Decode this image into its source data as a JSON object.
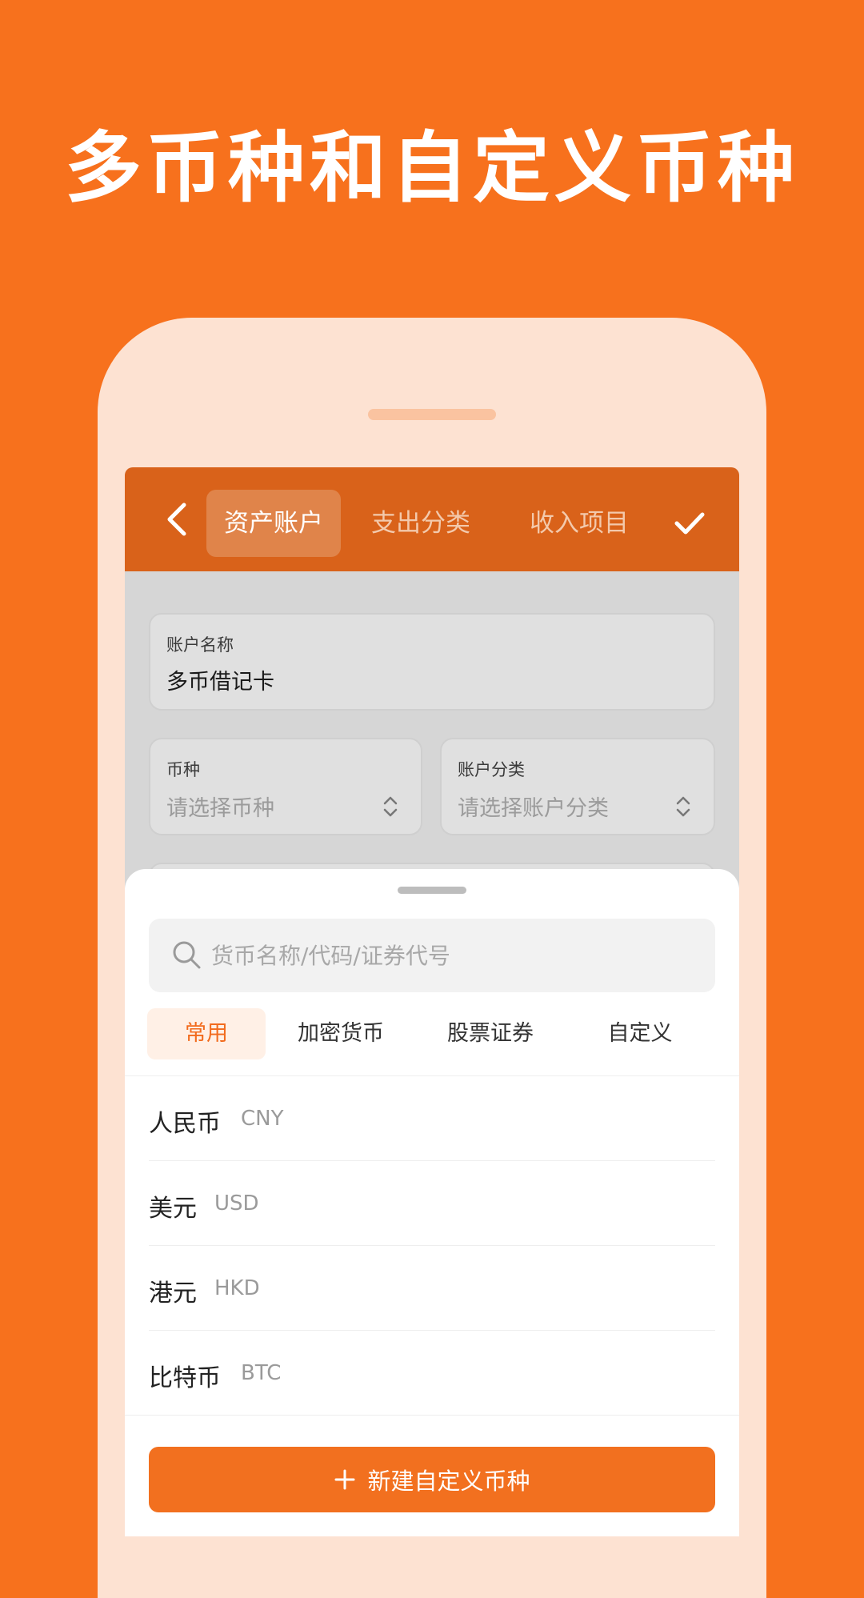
{
  "headline": "多币种和自定义币种",
  "nav": {
    "back_icon": "chevron-left-icon",
    "tabs": [
      {
        "label": "资产账户",
        "active": true
      },
      {
        "label": "支出分类",
        "active": false
      },
      {
        "label": "收入项目",
        "active": false
      }
    ],
    "confirm_icon": "check-icon"
  },
  "form": {
    "account_name": {
      "label": "账户名称",
      "value": "多币借记卡"
    },
    "currency": {
      "label": "币种",
      "placeholder": "请选择币种"
    },
    "account_category": {
      "label": "账户分类",
      "placeholder": "请选择账户分类"
    }
  },
  "sheet": {
    "search_placeholder": "货币名称/代码/证券代号",
    "categories": [
      {
        "label": "常用",
        "active": true
      },
      {
        "label": "加密货币",
        "active": false
      },
      {
        "label": "股票证券",
        "active": false
      },
      {
        "label": "自定义",
        "active": false
      }
    ],
    "currencies": [
      {
        "name": "人民币",
        "code": "CNY"
      },
      {
        "name": "美元",
        "code": "USD"
      },
      {
        "name": "港元",
        "code": "HKD"
      },
      {
        "name": "比特币",
        "code": "BTC"
      }
    ],
    "new_button_label": "新建自定义币种"
  },
  "colors": {
    "background": "#F7711D",
    "nav_bar": "#D9621A",
    "accent": "#F2701F"
  }
}
